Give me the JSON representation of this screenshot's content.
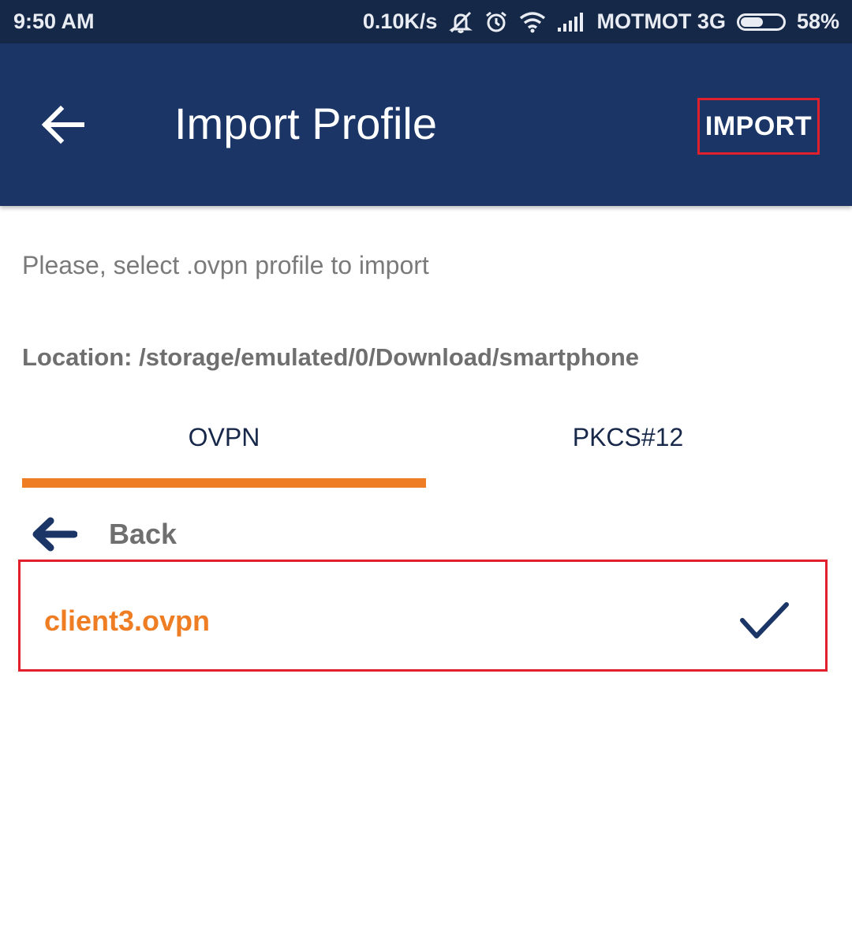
{
  "status_bar": {
    "time": "9:50 AM",
    "net_speed": "0.10K/s",
    "carrier": "MOTMOT 3G",
    "battery": "58%",
    "battery_level": 0.58,
    "icons": [
      "muted-bell-icon",
      "alarm-icon",
      "wifi-icon",
      "signal-icon",
      "battery-icon"
    ]
  },
  "app_bar": {
    "title": "Import Profile",
    "import_label": "IMPORT",
    "background": "#1b3666"
  },
  "content": {
    "instruction": "Please, select .ovpn profile to import",
    "location": "Location: /storage/emulated/0/Download/smartphone"
  },
  "tabs": [
    {
      "label": "OVPN",
      "selected": true
    },
    {
      "label": "PKCS#12",
      "selected": false
    }
  ],
  "file_browser": {
    "back_label": "Back",
    "files": [
      {
        "name": "client3.ovpn",
        "selected": true
      }
    ]
  },
  "colors": {
    "accent": "#ee7d23",
    "navy": "#1b3666",
    "highlight_border": "#e0202c"
  }
}
